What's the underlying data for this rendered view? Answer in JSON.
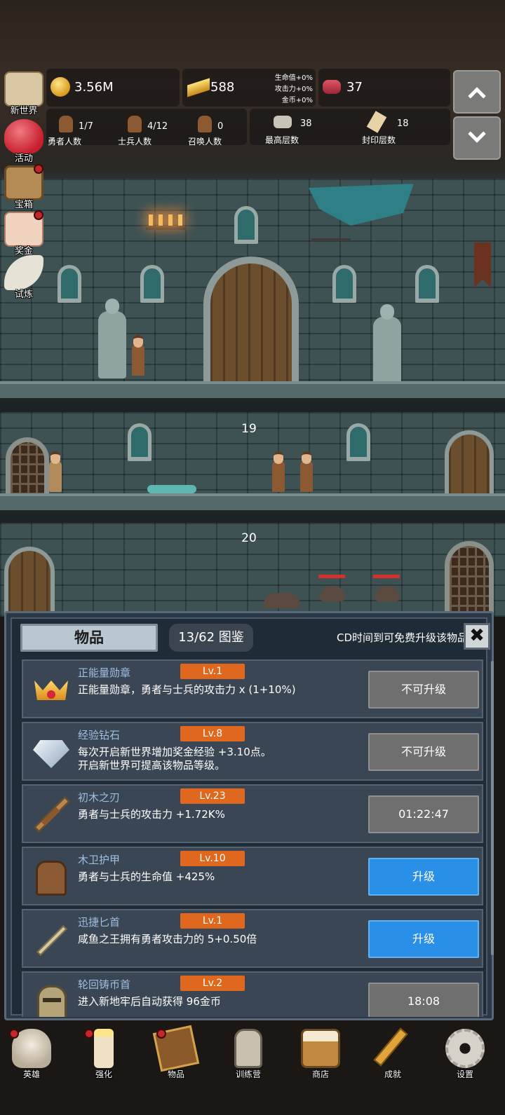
{
  "hud": {
    "gold": "3.56M",
    "bars": "588",
    "bonuses": [
      "生命值+0%",
      "攻击力+0%",
      "金币+0%"
    ],
    "gems": "37",
    "heroes": {
      "value": "1/7",
      "label": "勇者人数"
    },
    "soldiers": {
      "value": "4/12",
      "label": "士兵人数"
    },
    "summons": {
      "value": "0",
      "label": "召唤人数"
    },
    "max_floor": {
      "value": "38",
      "label": "最高层数"
    },
    "sealed_floor": {
      "value": "18",
      "label": "封印层数"
    }
  },
  "side_menu": [
    {
      "label": "新世界",
      "icon": "map-icon",
      "dot": false
    },
    {
      "label": "活动",
      "icon": "heart-icon",
      "dot": false
    },
    {
      "label": "宝箱",
      "icon": "chest-icon",
      "dot": true
    },
    {
      "label": "奖金",
      "icon": "envelope-icon",
      "dot": true
    },
    {
      "label": "试炼",
      "icon": "wing-icon",
      "dot": false
    }
  ],
  "scene": {
    "floors": [
      "19",
      "20"
    ]
  },
  "panel": {
    "tab_label": "物品",
    "collection_label": "13/62 图鉴",
    "cd_note": "CD时间到可免费升级该物品",
    "close_symbol": "✖",
    "items": [
      {
        "name": "正能量勋章",
        "level": "Lv.1",
        "desc": [
          "正能量勋章，勇者与士兵的攻击力 x (1+10%)"
        ],
        "button": "不可升级",
        "button_style": "gray",
        "icon": "crown-medal-icon"
      },
      {
        "name": "经验钻石",
        "level": "Lv.8",
        "desc": [
          "每次开启新世界增加奖金经验 +3.10点。",
          "开启新世界可提高该物品等级。"
        ],
        "button": "不可升级",
        "button_style": "gray",
        "icon": "diamond-icon"
      },
      {
        "name": "初木之刃",
        "level": "Lv.23",
        "desc": [
          "勇者与士兵的攻击力 +1.72K%"
        ],
        "button": "01:22:47",
        "button_style": "gray",
        "icon": "wooden-sword-icon"
      },
      {
        "name": "木卫护甲",
        "level": "Lv.10",
        "desc": [
          "勇者与士兵的生命值 +425%"
        ],
        "button": "升级",
        "button_style": "blue",
        "icon": "armor-icon"
      },
      {
        "name": "迅捷匕首",
        "level": "Lv.1",
        "desc": [
          "咸鱼之王拥有勇者攻击力的 5+0.50倍"
        ],
        "button": "升级",
        "button_style": "blue",
        "icon": "dagger-icon"
      },
      {
        "name": "轮回铸币首",
        "level": "Lv.2",
        "desc": [
          "进入新地牢后自动获得 96金币"
        ],
        "button": "18:08",
        "button_style": "gray",
        "icon": "helmet-icon"
      }
    ]
  },
  "nav": [
    {
      "label": "英雄",
      "icon": "skull-icon",
      "dot": true
    },
    {
      "label": "强化",
      "icon": "candle-icon",
      "dot": true
    },
    {
      "label": "物品",
      "icon": "book-icon",
      "dot": true
    },
    {
      "label": "训练营",
      "icon": "lantern-icon",
      "dot": false
    },
    {
      "label": "商店",
      "icon": "beer-mug-icon",
      "dot": false
    },
    {
      "label": "成就",
      "icon": "key-icon",
      "dot": false
    },
    {
      "label": "设置",
      "icon": "gear-icon",
      "dot": false
    }
  ],
  "colors": {
    "accent_orange": "#e0681e",
    "button_blue": "#2a8fe6",
    "button_gray": "#6f6f6f",
    "item_name": "#9fbfe2"
  }
}
